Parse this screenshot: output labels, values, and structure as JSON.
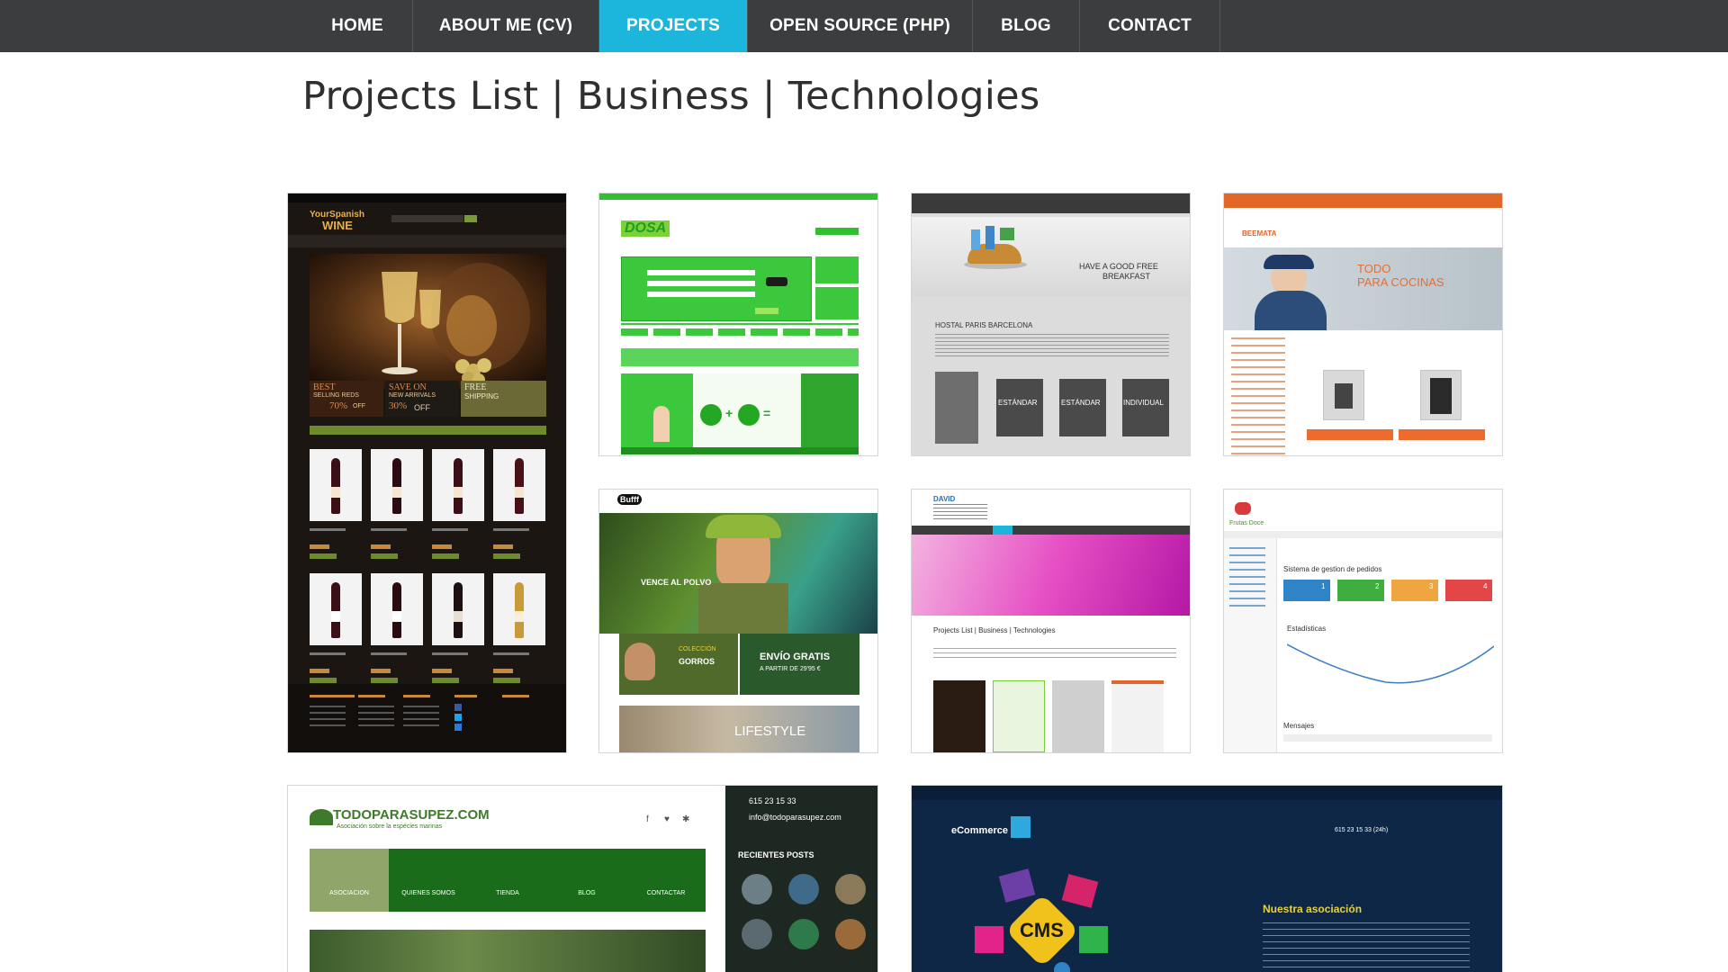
{
  "nav": {
    "items": [
      "HOME",
      "ABOUT ME (CV)",
      "PROJECTS",
      "OPEN SOURCE (PHP)",
      "BLOG",
      "CONTACT"
    ],
    "active": "PROJECTS",
    "colors": {
      "bar": "#3b3d3f",
      "active": "#1cb5dc"
    }
  },
  "page": {
    "title": "Projects List | Business | Technologies"
  },
  "thumbs": {
    "wine": {
      "logo_top": "YourSpanish",
      "logo_bottom": "WINE",
      "promo1_top": "BEST",
      "promo1_mid": "SELLING REDS",
      "promo1_value": "70%",
      "promo1_suffix": "OFF",
      "promo2_top": "SAVE ON",
      "promo2_mid": "NEW ARRIVALS",
      "promo2_value": "30%",
      "promo2_suffix": "OFF",
      "promo3_top": "FREE",
      "promo3_mid": "SHIPPING"
    },
    "dosa": {
      "logo": "DOSA"
    },
    "hostal": {
      "banner_line1": "HAVE A GOOD FREE",
      "banner_line2": "BREAKFAST",
      "heading": "HOSTAL PARIS BARCELONA",
      "rooms": [
        "ESTÁNDAR",
        "ESTÁNDAR",
        "INDIVIDUAL"
      ]
    },
    "cocinas": {
      "logo": "BEEMATA",
      "headline1": "TODO",
      "headline2": "PARA COCINAS"
    },
    "outdoor": {
      "logo": "Bufff",
      "hero_text": "VENCE AL POLVO",
      "promo_envio1": "ENVÍO GRATIS",
      "promo_envio2": "A PARTIR DE 29'95 €",
      "promo_gorros1": "COLECCIÓN",
      "promo_gorros2": "GORROS",
      "promo_lifestyle": "LIFESTYLE"
    },
    "david": {
      "logo": "DAVID",
      "inner_title": "Projects List | Business | Technologies"
    },
    "pedidos": {
      "brand": "Frutas Doce",
      "heading": "Sistema de gestion de pedidos",
      "stats_title": "Estadísticas",
      "messages_title": "Mensajes",
      "stats": [
        "1",
        "2",
        "3",
        "4"
      ]
    },
    "pesca": {
      "logo": "TODOPARASUPEZ.COM",
      "tagline": "Asociación sobre la espécies marinas",
      "menu": [
        "ASOCIACION",
        "QUIENES SOMOS",
        "TIENDA",
        "BLOG",
        "CONTACTAR"
      ],
      "phone": "615 23 15 33",
      "email": "info@todoparasupez.com",
      "recent": "RECIENTES POSTS"
    },
    "ecommerce": {
      "logo": "eCommerce",
      "cms": "CMS",
      "heading": "Nuestra asociación",
      "phone": "615 23 15 33 (24h)"
    }
  }
}
